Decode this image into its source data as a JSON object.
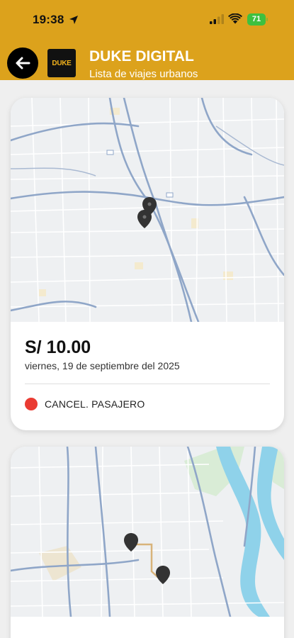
{
  "status_bar": {
    "time": "19:38",
    "battery": "71"
  },
  "header": {
    "title": "DUKE DIGITAL",
    "subtitle": "Lista de viajes urbanos",
    "logo_text": "DUKE",
    "color": "#dca21c"
  },
  "trips": [
    {
      "price": "S/ 10.00",
      "date": "viernes, 19 de septiembre del 2025",
      "status": "CANCEL. PASAJERO",
      "status_color": "#ea3b32"
    }
  ],
  "icons": [
    "back-arrow-icon",
    "location-arrow-icon",
    "signal-icon",
    "wifi-icon",
    "battery-icon",
    "map-pin-icon"
  ]
}
